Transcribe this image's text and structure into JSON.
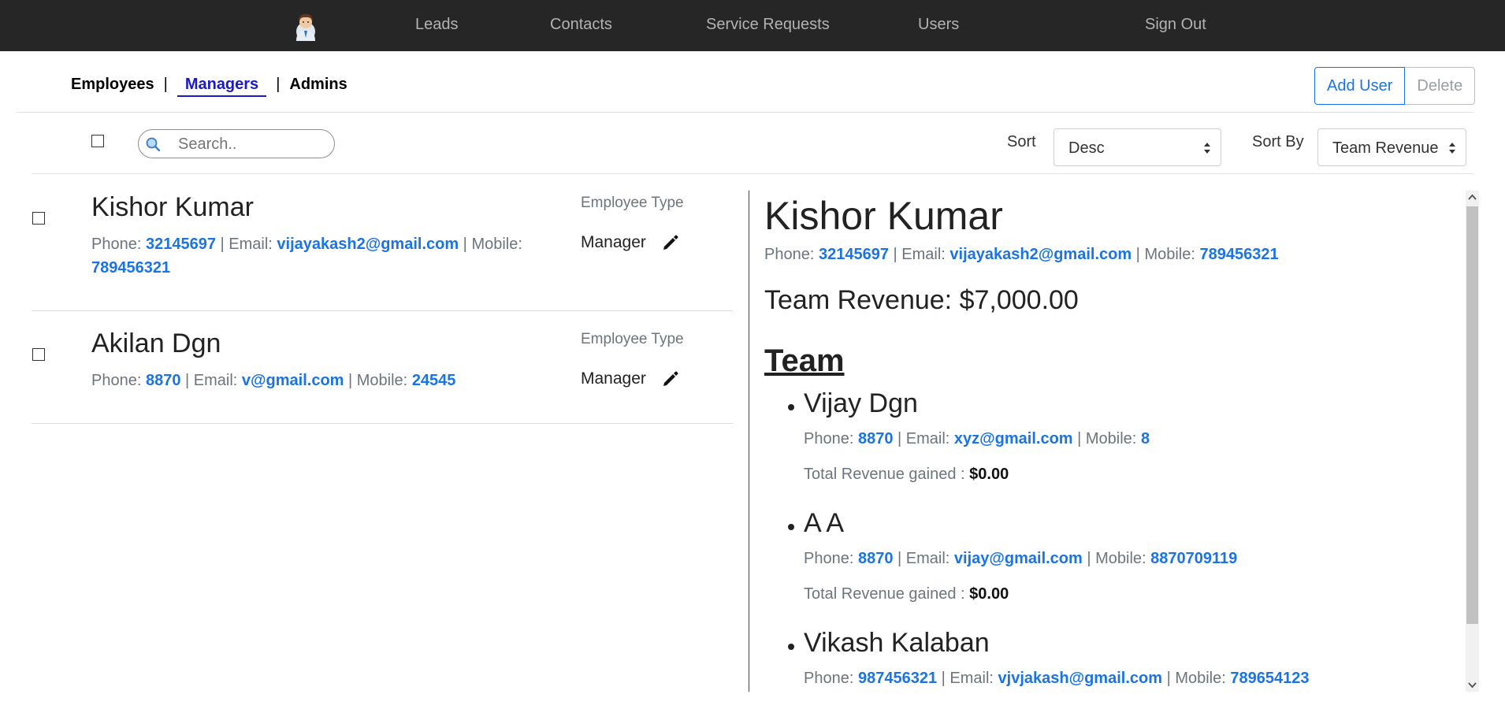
{
  "nav": {
    "avatar_icon": "user-avatar-icon",
    "items": [
      "Leads",
      "Contacts",
      "Service Requests",
      "Users",
      "Sign Out"
    ]
  },
  "tabs": {
    "employees": "Employees",
    "separator": "|",
    "managers": "Managers",
    "admins": "Admins",
    "active": "Managers"
  },
  "actions": {
    "add_user": "Add User",
    "delete": "Delete"
  },
  "toolbar": {
    "search_placeholder": "Search..",
    "sort_label": "Sort",
    "sort_value": "Desc",
    "sort_by_label": "Sort By",
    "sort_by_value": "Team Revenue"
  },
  "list": [
    {
      "name": "Kishor Kumar",
      "phone_label": "Phone:",
      "phone": "32145697",
      "email_label": "Email:",
      "email": "vijayakash2@gmail.com",
      "mobile_label": "Mobile:",
      "mobile": "789456321",
      "employee_type_label": "Employee Type",
      "employee_type": "Manager"
    },
    {
      "name": "Akilan Dgn",
      "phone_label": "Phone:",
      "phone": "8870",
      "email_label": "Email:",
      "email": "v@gmail.com",
      "mobile_label": "Mobile:",
      "mobile": "24545",
      "employee_type_label": "Employee Type",
      "employee_type": "Manager"
    }
  ],
  "detail": {
    "name": "Kishor Kumar",
    "phone_label": "Phone:",
    "phone": "32145697",
    "email_label": "Email:",
    "email": "vijayakash2@gmail.com",
    "mobile_label": "Mobile:",
    "mobile": "789456321",
    "team_revenue": "Team Revenue: $7,000.00",
    "team_heading": "Team",
    "revenue_label": "Total Revenue gained :",
    "team": [
      {
        "name": "Vijay Dgn",
        "phone": "8870",
        "email": "xyz@gmail.com",
        "mobile": "8",
        "revenue": "$0.00"
      },
      {
        "name": "A A",
        "phone": "8870",
        "email": "vijay@gmail.com",
        "mobile": "8870709119",
        "revenue": "$0.00"
      },
      {
        "name": "Vikash Kalaban",
        "phone": "987456321",
        "email": "vjvjakash@gmail.com",
        "mobile": "789654123",
        "revenue": ""
      }
    ]
  },
  "colors": {
    "navbar": "#262626",
    "link": "#1a73e8",
    "active_tab": "#1a1acc"
  }
}
